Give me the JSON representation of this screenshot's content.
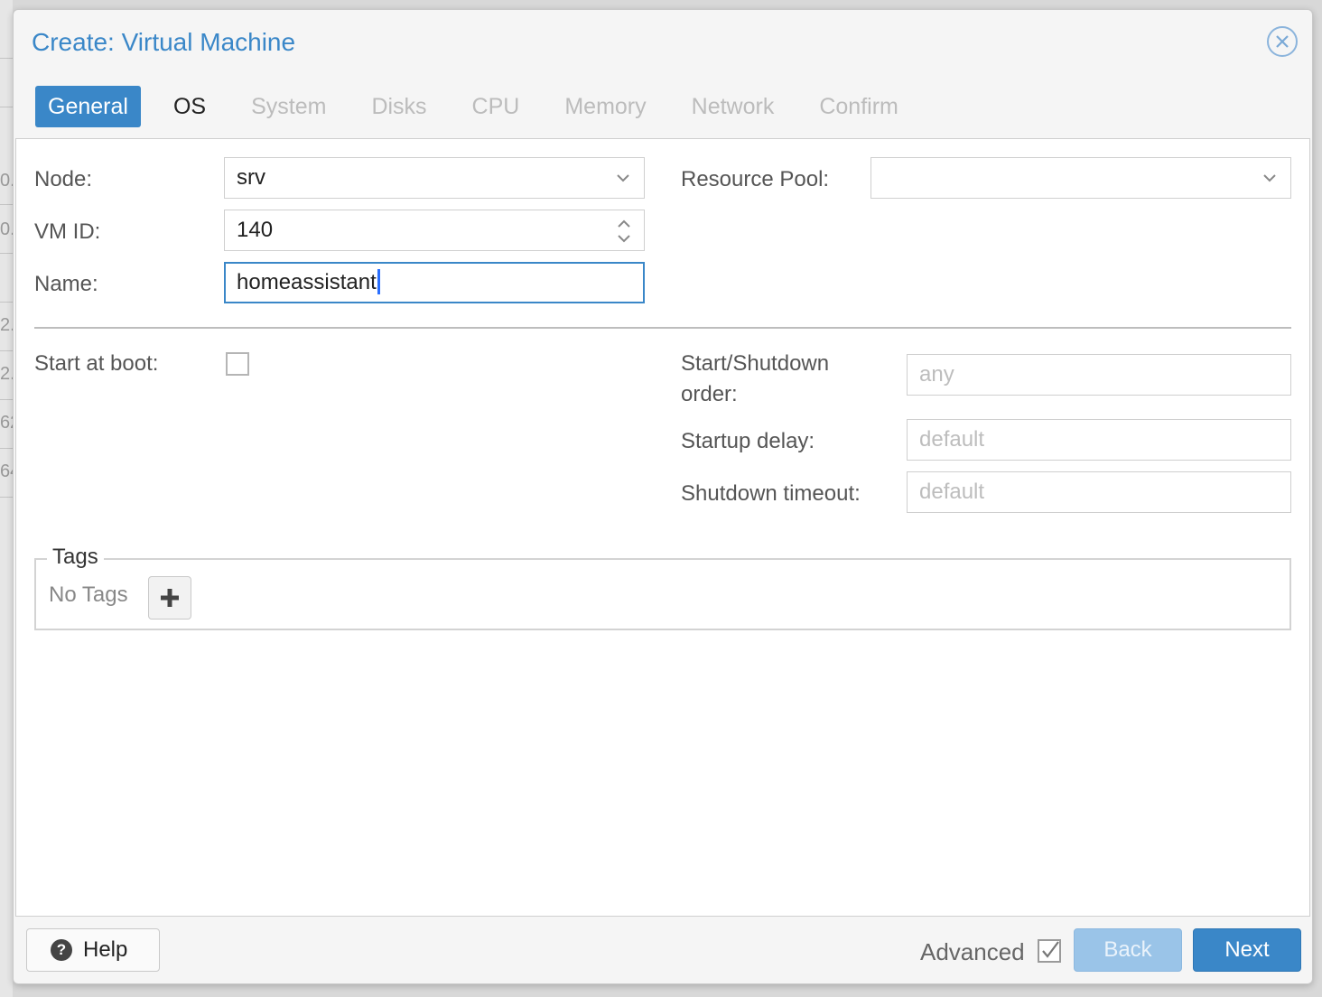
{
  "background": {
    "fragments": [
      "0.",
      "0.",
      "2.",
      "2.",
      "62",
      "64"
    ]
  },
  "dialog": {
    "title": "Create: Virtual Machine",
    "tabs": [
      "General",
      "OS",
      "System",
      "Disks",
      "CPU",
      "Memory",
      "Network",
      "Confirm"
    ],
    "active_tab": "General",
    "accent_color": "#3a87c8"
  },
  "form": {
    "node": {
      "label": "Node:",
      "value": "srv"
    },
    "vmid": {
      "label": "VM ID:",
      "value": "140"
    },
    "name": {
      "label": "Name:",
      "value": "homeassistant"
    },
    "resource_pool": {
      "label": "Resource Pool:",
      "value": ""
    },
    "start_at_boot": {
      "label": "Start at boot:",
      "checked": false
    },
    "start_order": {
      "label_line1": "Start/Shutdown",
      "label_line2": "order:",
      "placeholder": "any"
    },
    "startup_delay": {
      "label": "Startup delay:",
      "placeholder": "default"
    },
    "shutdown_timeout": {
      "label": "Shutdown timeout:",
      "placeholder": "default"
    }
  },
  "tags": {
    "legend": "Tags",
    "empty_text": "No Tags"
  },
  "footer": {
    "help_label": "Help",
    "advanced_label": "Advanced",
    "advanced_checked": true,
    "back_label": "Back",
    "next_label": "Next"
  }
}
